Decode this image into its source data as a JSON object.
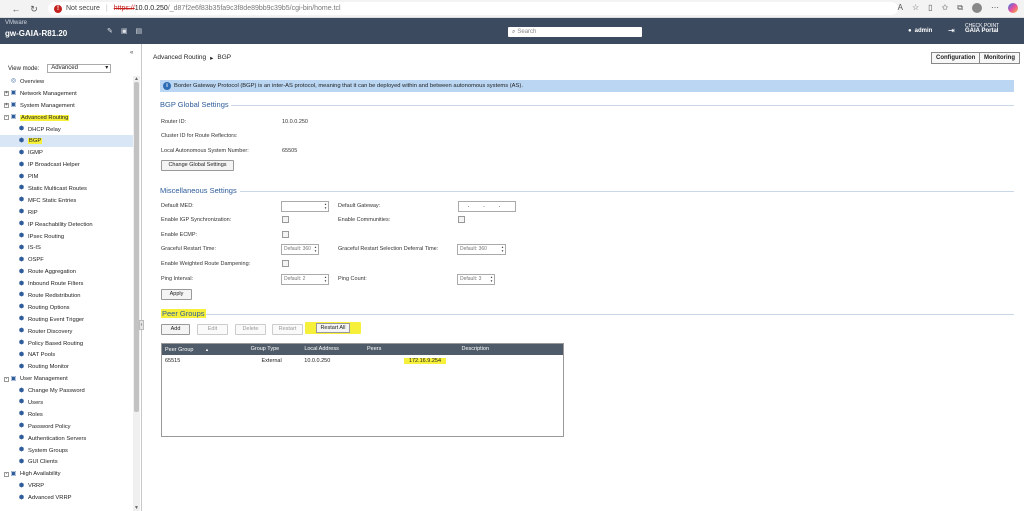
{
  "browser": {
    "not_secure": "Not secure",
    "url_scheme": "https://",
    "url_host": "10.0.0.250",
    "url_path": "/_d87f2e6f83b35fa9c3f8de89bb9c39b5/cgi-bin/home.tcl"
  },
  "header": {
    "vendor": "VMware",
    "hostname": "gw-GAIA-R81.20",
    "search_placeholder": "Search",
    "user": "admin",
    "portal_brand": "CHECK POINT",
    "portal_name": "GAIA Portal"
  },
  "sidebar": {
    "view_mode_label": "View mode:",
    "view_mode_value": "Advanced",
    "items": [
      {
        "label": "Overview",
        "level": 0
      },
      {
        "label": "Network Management",
        "level": 0,
        "expander": "+"
      },
      {
        "label": "System Management",
        "level": 0,
        "expander": "+"
      },
      {
        "label": "Advanced Routing",
        "level": 0,
        "expander": "-",
        "highlight": true
      },
      {
        "label": "DHCP Relay",
        "level": 1
      },
      {
        "label": "BGP",
        "level": 1,
        "selected": true,
        "highlight": true
      },
      {
        "label": "IGMP",
        "level": 1
      },
      {
        "label": "IP Broadcast Helper",
        "level": 1
      },
      {
        "label": "PIM",
        "level": 1
      },
      {
        "label": "Static Multicast Routes",
        "level": 1
      },
      {
        "label": "MFC Static Entries",
        "level": 1
      },
      {
        "label": "RIP",
        "level": 1
      },
      {
        "label": "IP Reachability Detection",
        "level": 1
      },
      {
        "label": "IPsec Routing",
        "level": 1
      },
      {
        "label": "IS-IS",
        "level": 1
      },
      {
        "label": "OSPF",
        "level": 1
      },
      {
        "label": "Route Aggregation",
        "level": 1
      },
      {
        "label": "Inbound Route Filters",
        "level": 1
      },
      {
        "label": "Route Redistribution",
        "level": 1
      },
      {
        "label": "Routing Options",
        "level": 1
      },
      {
        "label": "Routing Event Trigger",
        "level": 1
      },
      {
        "label": "Router Discovery",
        "level": 1
      },
      {
        "label": "Policy Based Routing",
        "level": 1
      },
      {
        "label": "NAT Pools",
        "level": 1
      },
      {
        "label": "Routing Monitor",
        "level": 1
      },
      {
        "label": "User Management",
        "level": 0,
        "expander": "-"
      },
      {
        "label": "Change My Password",
        "level": 1
      },
      {
        "label": "Users",
        "level": 1
      },
      {
        "label": "Roles",
        "level": 1
      },
      {
        "label": "Password Policy",
        "level": 1
      },
      {
        "label": "Authentication Servers",
        "level": 1
      },
      {
        "label": "System Groups",
        "level": 1
      },
      {
        "label": "GUI Clients",
        "level": 1
      },
      {
        "label": "High Availability",
        "level": 0,
        "expander": "-"
      },
      {
        "label": "VRRP",
        "level": 1
      },
      {
        "label": "Advanced VRRP",
        "level": 1
      }
    ]
  },
  "main": {
    "breadcrumb_parent": "Advanced Routing",
    "breadcrumb_current": "BGP",
    "configuration_btn": "Configuration",
    "monitoring_btn": "Monitoring",
    "info_text": "Border Gateway Protocol (BGP) is an inter-AS protocol, meaning that it can be deployed within and between autonomous systems (AS).",
    "global": {
      "title": "BGP Global Settings",
      "router_id_label": "Router ID:",
      "router_id_value": "10.0.0.250",
      "cluster_id_label": "Cluster ID for Route Reflectors:",
      "local_as_label": "Local Autonomous System Number:",
      "local_as_value": "65505",
      "change_btn": "Change Global Settings"
    },
    "misc": {
      "title": "Miscellaneous Settings",
      "default_med_label": "Default MED:",
      "default_gateway_label": "Default Gateway:",
      "default_gateway_value": ". . .",
      "igp_sync_label": "Enable IGP Synchronization:",
      "communities_label": "Enable Communities:",
      "ecmp_label": "Enable ECMP:",
      "graceful_restart_label": "Graceful Restart Time:",
      "graceful_restart_value": "Default: 360",
      "deferral_label": "Graceful Restart Selection Deferral Time:",
      "deferral_value": "Default: 360",
      "dampening_label": "Enable Weighted Route Dampening:",
      "ping_interval_label": "Ping Interval:",
      "ping_interval_value": "Default: 2",
      "ping_count_label": "Ping Count:",
      "ping_count_value": "Default: 3",
      "apply_btn": "Apply"
    },
    "peers": {
      "title": "Peer Groups",
      "add_btn": "Add",
      "edit_btn": "Edit",
      "delete_btn": "Delete",
      "restart_btn": "Restart",
      "restart_all_btn": "Restart All",
      "columns": [
        "Peer Group",
        "Group Type",
        "Local Address",
        "Peers",
        "Description"
      ],
      "sort_indicator": "▲",
      "rows": [
        {
          "peer_group": "65515",
          "group_type": "External",
          "local_address": "10.0.0.250",
          "peers": "172.16.9.254",
          "description": ""
        }
      ]
    }
  },
  "colors": {
    "header_bg": "#3b4a5e",
    "highlight": "#f6f03a",
    "info_bg": "#bad6f2",
    "section_title": "#2e5c9a",
    "table_header": "#4f5b69"
  }
}
